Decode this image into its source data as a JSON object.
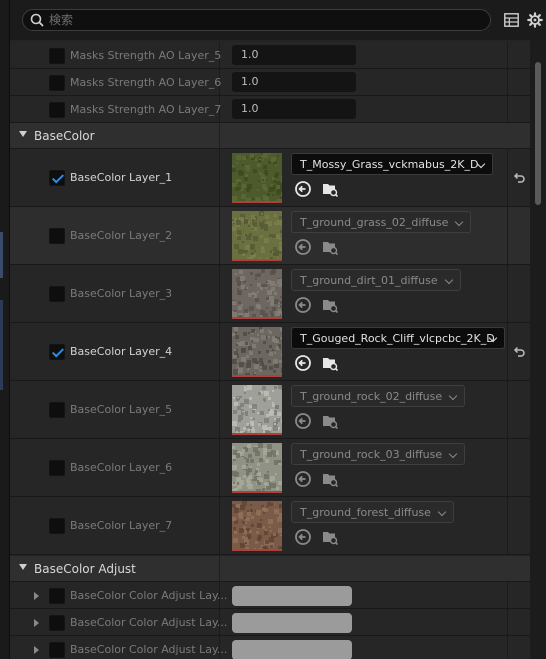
{
  "search": {
    "placeholder": "検索",
    "value": ""
  },
  "toolbar": {
    "table_icon": "table-icon",
    "settings_icon": "gear-icon"
  },
  "ao_rows": [
    {
      "label": "Masks Strength AO Layer_5",
      "value": "1.0"
    },
    {
      "label": "Masks Strength AO Layer_6",
      "value": "1.0"
    },
    {
      "label": "Masks Strength AO Layer_7",
      "value": "1.0"
    }
  ],
  "basecolor": {
    "category": "BaseColor",
    "layers": [
      {
        "label": "BaseColor Layer_1",
        "checked": true,
        "texture": "T_Mossy_Grass_vckmabus_2K_D",
        "swatch": [
          "#4c5a2c",
          "#5c6a35",
          "#3c4a22"
        ]
      },
      {
        "label": "BaseColor Layer_2",
        "checked": false,
        "texture": "T_ground_grass_02_diffuse",
        "swatch": [
          "#6a7040",
          "#7d7f4c",
          "#565a33"
        ]
      },
      {
        "label": "BaseColor Layer_3",
        "checked": false,
        "texture": "T_ground_dirt_01_diffuse",
        "swatch": [
          "#6e6660",
          "#85807a",
          "#58504a"
        ]
      },
      {
        "label": "BaseColor Layer_4",
        "checked": true,
        "texture": "T_Gouged_Rock_Cliff_vlcpcbc_2K_D",
        "swatch": [
          "#6c6760",
          "#858077",
          "#4f4a44"
        ]
      },
      {
        "label": "BaseColor Layer_5",
        "checked": false,
        "texture": "T_ground_rock_02_diffuse",
        "swatch": [
          "#9fa09a",
          "#bfc0b8",
          "#7b7c75"
        ]
      },
      {
        "label": "BaseColor Layer_6",
        "checked": false,
        "texture": "T_ground_rock_03_diffuse",
        "swatch": [
          "#8f9284",
          "#a9ab9c",
          "#6d7062"
        ]
      },
      {
        "label": "BaseColor Layer_7",
        "checked": false,
        "texture": "T_ground_forest_diffuse",
        "swatch": [
          "#7a5b48",
          "#93705a",
          "#5e4437"
        ]
      }
    ]
  },
  "adjust": {
    "category": "BaseColor Adjust",
    "rows": [
      {
        "label": "BaseColor Color Adjust Lay..."
      },
      {
        "label": "BaseColor Color Adjust Lay..."
      },
      {
        "label": "BaseColor Color Adjust Lay..."
      }
    ]
  },
  "colors": {
    "accent": "#2f8de4",
    "thumb_underline": "#b0403a"
  }
}
